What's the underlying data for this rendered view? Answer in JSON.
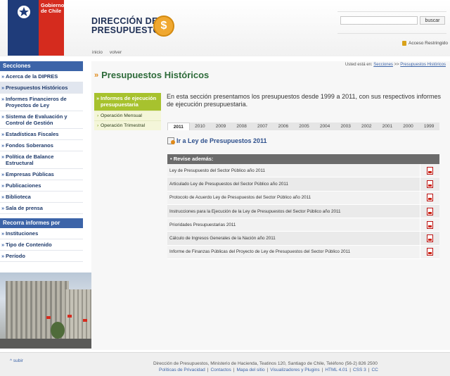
{
  "header": {
    "gob_line1": "Gobierno",
    "gob_line2": "de Chile",
    "dipres_line1": "DIRECCIÓN DE",
    "dipres_line2": "PRESUPUESTOS",
    "coin_symbol": "$",
    "search_placeholder": "",
    "search_button": "buscar",
    "acceso": "Acceso Restringido",
    "nav_inicio": "inicio",
    "nav_volver": "volver"
  },
  "sidebar": {
    "secciones_title": "Secciones",
    "items": [
      "Acerca de la DIPRES",
      "Presupuestos Históricos",
      "Informes Financieros de Proyectos de Ley",
      "Sistema de Evaluación y Control de Gestión",
      "Estadísticas Fiscales",
      "Fondos Soberanos",
      "Política de Balance Estructural",
      "Empresas Públicas",
      "Publicaciones",
      "Biblioteca",
      "Sala de prensa"
    ],
    "recorra_title": "Recorra informes por",
    "recorra_items": [
      "Instituciones",
      "Tipo de Contenido",
      "Período"
    ]
  },
  "breadcrumb": {
    "prefix": "Usted está en:",
    "link1": "Secciones",
    "sep": ">>",
    "link2": "Presupuestos Históricos"
  },
  "main": {
    "title": "Presupuestos Históricos",
    "submenu_head": "Informes de ejecución presupuestaria",
    "submenu_items": [
      "Operación Mensual",
      "Operación Trimestral"
    ],
    "intro": "En esta sección presentamos los presupuestos desde 1999 a 2011, con sus respectivos informes de ejecución presupuestaria.",
    "years": [
      "2011",
      "2010",
      "2009",
      "2008",
      "2007",
      "2006",
      "2005",
      "2004",
      "2003",
      "2002",
      "2001",
      "2000",
      "1999"
    ],
    "active_year": "2011",
    "ley_link": "Ir a Ley de Presupuestos 2011",
    "revise_head": "Revise además:",
    "documents": [
      "Ley de Presupuesto del Sector Público año 2011",
      "Articulado Ley de Presupuestos del Sector Público año 2011",
      "Protocolo de Acuerdo Ley de Presupuestos del Sector Público año 2011",
      "Instrucciones para la Ejecución de la Ley de Presupuestos del Sector Público año 2011",
      "Prioridades Presupuestarias 2011",
      "Cálculo de Ingresos Generales de la Nación año 2011",
      "Informe de Finanzas Públicas del Proyecto de Ley de Presupuestos del Sector Público 2011"
    ]
  },
  "footer": {
    "subir": "subir",
    "address": "Dirección de Presupuestos, Ministerio de Hacienda, Teatinos 120, Santiago de Chile, Teléfono (56-2) 826 2500",
    "links": [
      "Políticas de Privacidad",
      "Contactos",
      "Mapa del sitio",
      "Visualizadores y Plugins",
      "HTML 4.01",
      "CSS 3",
      "CC"
    ]
  },
  "colors": {
    "nav_blue": "#3c64a8",
    "title_green": "#2e6b3a",
    "submenu_green": "#a7c22e",
    "chile_red": "#d52b1e",
    "chile_blue": "#1f3c7a",
    "accent_orange": "#f0a830"
  }
}
